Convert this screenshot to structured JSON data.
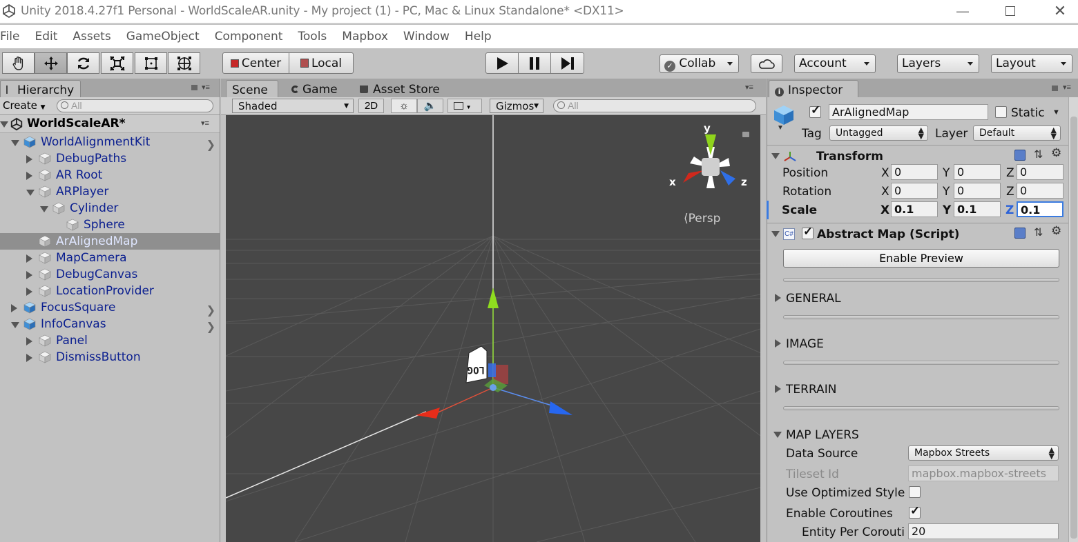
{
  "window": {
    "title": "Unity 2018.4.27f1 Personal - WorldScaleAR.unity - My project (1) - PC, Mac & Linux Standalone* <DX11>",
    "minimize_icon": "minimize-icon",
    "maximize_icon": "maximize-icon",
    "close_icon": "close-icon"
  },
  "menu": [
    "File",
    "Edit",
    "Assets",
    "GameObject",
    "Component",
    "Tools",
    "Mapbox",
    "Window",
    "Help"
  ],
  "toolbar": {
    "pivot": "Center",
    "space": "Local",
    "collab": "Collab",
    "account": "Account",
    "layers": "Layers",
    "layout": "Layout"
  },
  "hierarchy": {
    "tab": "Hierarchy",
    "create": "Create",
    "search_placeholder": "All",
    "scene_name": "WorldScaleAR*",
    "items": [
      "WorldAlignmentKit",
      "DebugPaths",
      "AR Root",
      "ARPlayer",
      "Cylinder",
      "Sphere",
      "ArAlignedMap",
      "MapCamera",
      "DebugCanvas",
      "LocationProvider",
      "FocusSquare",
      "InfoCanvas",
      "Panel",
      "DismissButton"
    ]
  },
  "scene": {
    "tabs": [
      "Scene",
      "Game",
      "Asset Store"
    ],
    "shading": "Shaded",
    "mode_2d": "2D",
    "gizmos": "Gizmos",
    "search_placeholder": "All",
    "persp": "Persp",
    "axis_x": "x",
    "axis_y": "y",
    "axis_z": "z"
  },
  "inspector": {
    "tab": "Inspector",
    "object_name": "ArAlignedMap",
    "static_label": "Static",
    "tag_label": "Tag",
    "tag_value": "Untagged",
    "layer_label": "Layer",
    "layer_value": "Default",
    "transform": {
      "title": "Transform",
      "position_label": "Position",
      "rotation_label": "Rotation",
      "scale_label": "Scale",
      "x": "X",
      "y": "Y",
      "z": "Z",
      "position": [
        "0",
        "0",
        "0"
      ],
      "rotation": [
        "0",
        "0",
        "0"
      ],
      "scale": [
        "0.1",
        "0.1",
        "0.1"
      ]
    },
    "script": {
      "title": "Abstract Map (Script)",
      "preview_button": "Enable Preview",
      "general": "GENERAL",
      "image": "IMAGE",
      "terrain": "TERRAIN",
      "map_layers": "MAP LAYERS",
      "data_source_label": "Data Source",
      "data_source_value": "Mapbox Streets",
      "tileset_label": "Tileset Id",
      "tileset_value": "mapbox.mapbox-streets",
      "optimized_label": "Use Optimized Style",
      "coroutines_label": "Enable Coroutines",
      "entity_label": "Entity Per Corouti",
      "entity_value": "20"
    }
  }
}
